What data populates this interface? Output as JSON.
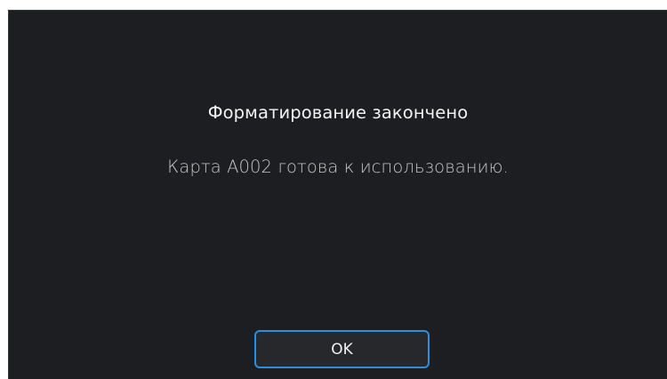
{
  "dialog": {
    "title": "Форматирование закончено",
    "message": "Карта A002 готова к использованию.",
    "ok_label": "OK"
  },
  "colors": {
    "background": "#1d1e21",
    "accent": "#2a8fe0",
    "title_text": "#f2f2f2",
    "message_text": "#c6c6c6"
  }
}
